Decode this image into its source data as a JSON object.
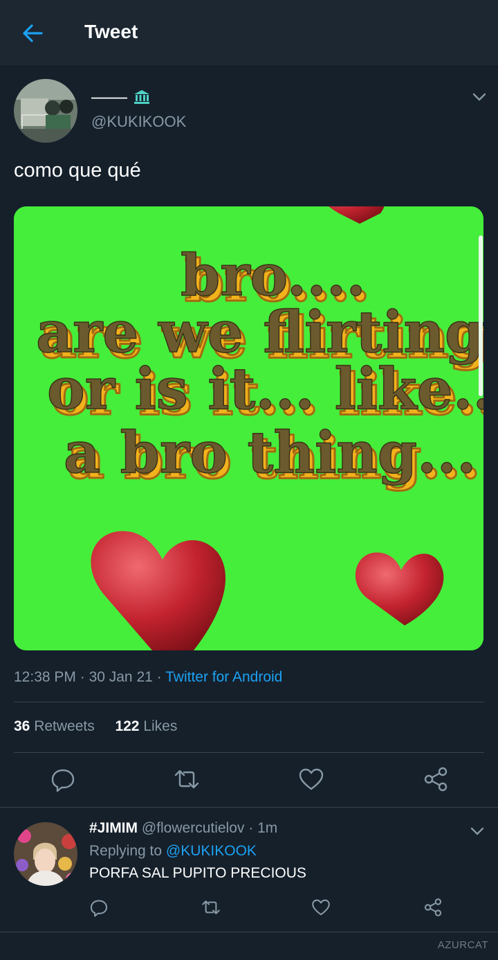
{
  "header": {
    "title": "Tweet"
  },
  "tweet": {
    "display_name": "——",
    "handle": "@KUKIKOOK",
    "text": "como que qué",
    "image_text": [
      "bro....",
      "are we flirting",
      "or is it... like...",
      "a bro thing..."
    ],
    "time": "12:38 PM",
    "date": "30 Jan 21",
    "source": "Twitter for Android",
    "retweets_count": "36",
    "retweets_label": "Retweets",
    "likes_count": "122",
    "likes_label": "Likes"
  },
  "reply": {
    "display_name": "#JIMIM",
    "handle": "@flowercutielov",
    "time": "1m",
    "replying_prefix": "Replying to",
    "replying_to": "@KUKIKOOK",
    "text": "PORFA SAL PUPITO PRECIOUS"
  },
  "watermark": "AZURCAT",
  "colors": {
    "background": "#15202b",
    "topbar": "#1c2732",
    "accent": "#1da1f2",
    "secondary_text": "#8899a6",
    "divider": "#38444d",
    "badge": "#4fd1c5",
    "image_bg": "#45ee3a"
  },
  "icons": [
    "back-arrow-icon",
    "bank-icon",
    "chevron-down-icon",
    "reply-icon",
    "retweet-icon",
    "like-icon",
    "share-icon"
  ]
}
